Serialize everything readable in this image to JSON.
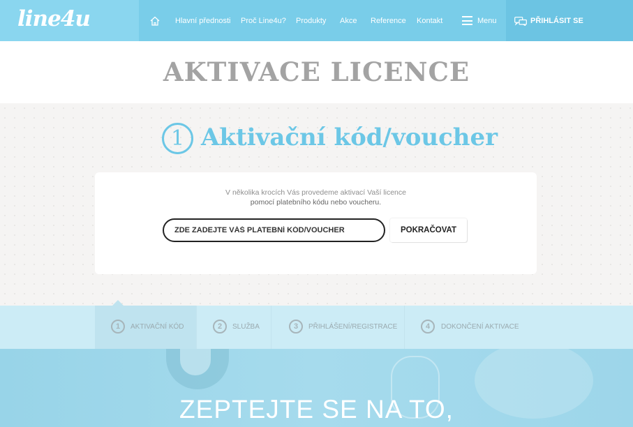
{
  "header": {
    "logo": "line4u",
    "nav": [
      "Hlavní přednosti",
      "Proč Line4u?",
      "Produkty",
      "Akce",
      "Reference",
      "Kontakt"
    ],
    "menu_label": "Menu",
    "login_label": "PŘIHLÁSIT SE"
  },
  "page_title": "AKTIVACE LICENCE",
  "step_heading": {
    "number": "1",
    "text": "Aktivační kód/voucher"
  },
  "form": {
    "intro_line1": "V několika krocích Vás provedeme aktivací Vaší licence",
    "intro_line2": "pomocí platebního kódu nebo voucheru.",
    "input_placeholder": "ZDE ZADEJTE VÁŠ PLATEBNÍ KÓD/VOUCHER",
    "submit_label": "POKRAČOVAT"
  },
  "steps": [
    {
      "number": "1",
      "label": "AKTIVAČNÍ KÓD",
      "active": true
    },
    {
      "number": "2",
      "label": "SLUŽBA",
      "active": false
    },
    {
      "number": "3",
      "label": "PŘIHLÁŠENÍ/REGISTRACE",
      "active": false
    },
    {
      "number": "4",
      "label": "DOKONČENÍ AKTIVACE",
      "active": false
    }
  ],
  "hero_text": "ZEPTEJTE SE NA TO,",
  "colors": {
    "header_bg": "#79cde9",
    "accent": "#6cc7e6",
    "steps_bg": "#ccecf6"
  }
}
